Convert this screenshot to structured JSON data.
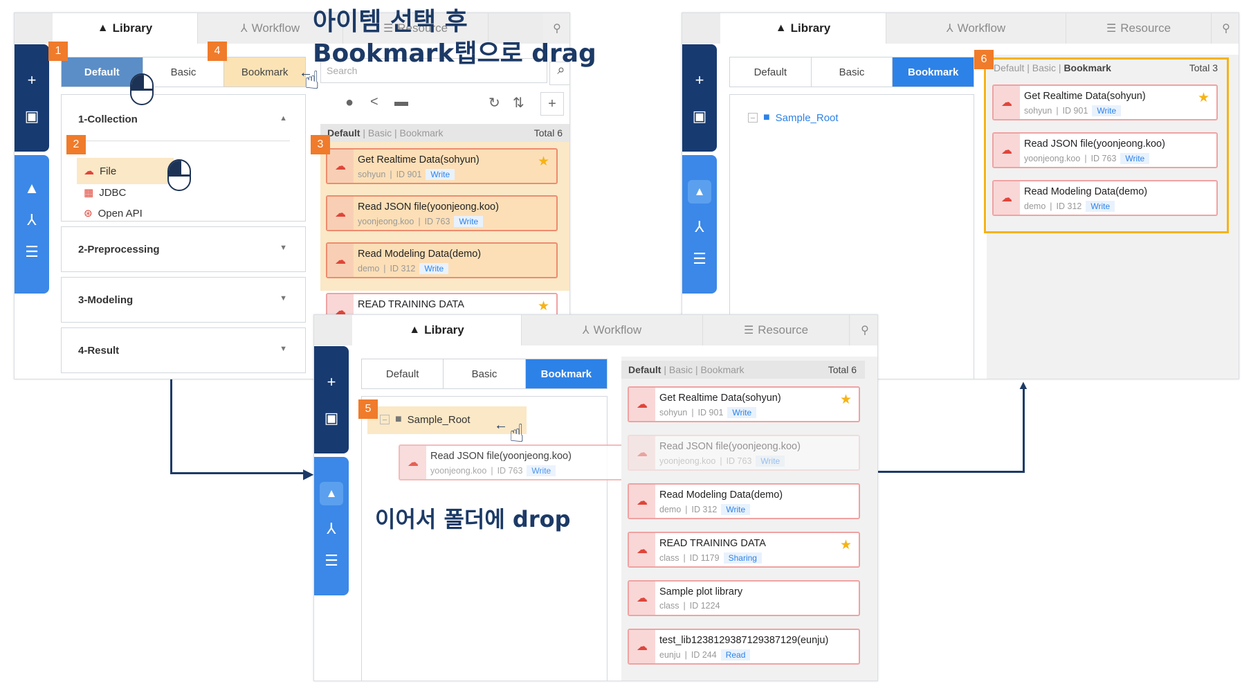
{
  "captions": {
    "step_top_line1": "아이템 선택 후",
    "step_top_line2": "Bookmark탭으로 drag",
    "step_bottom": "이어서 폴더에 drop"
  },
  "tabs": {
    "library": "Library",
    "workflow": "Workflow",
    "resource": "Resource"
  },
  "subtabs": {
    "default": "Default",
    "basic": "Basic",
    "bookmark": "Bookmark"
  },
  "step_numbers": [
    "1",
    "2",
    "3",
    "4",
    "5",
    "6"
  ],
  "accordion": {
    "collection": "1-Collection",
    "items": [
      "File",
      "JDBC",
      "Open API"
    ],
    "preprocessing": "2-Preprocessing",
    "modeling": "3-Modeling",
    "result": "4-Result"
  },
  "search": {
    "placeholder": "Search"
  },
  "list_header": {
    "default": "Default",
    "basic": "Basic",
    "bookmark": "Bookmark",
    "total6": "Total  6",
    "total3": "Total  3"
  },
  "tree": {
    "root": "Sample_Root"
  },
  "cards": [
    {
      "title": "Get Realtime Data(sohyun)",
      "user": "sohyun",
      "id": "ID 901",
      "perm": "Write",
      "star": true
    },
    {
      "title": "Read JSON file(yoonjeong.koo)",
      "user": "yoonjeong.koo",
      "id": "ID 763",
      "perm": "Write",
      "star": false
    },
    {
      "title": "Read Modeling Data(demo)",
      "user": "demo",
      "id": "ID 312",
      "perm": "Write",
      "star": false
    },
    {
      "title": "READ TRAINING DATA",
      "user": "class",
      "id": "ID 1179",
      "perm": "Sharing",
      "star": true
    },
    {
      "title": "Sample plot library",
      "user": "class",
      "id": "ID 1224",
      "perm": "",
      "star": false
    },
    {
      "title": "test_lib1238129387129387129(eunju)",
      "user": "eunju",
      "id": "ID 244",
      "perm": "Read",
      "star": false
    }
  ],
  "colors": {
    "navy": "#173a70",
    "blue": "#2d82e7",
    "accent_orange": "#f07b2a",
    "highlight": "#fbe3b5",
    "star": "#f5b317"
  }
}
